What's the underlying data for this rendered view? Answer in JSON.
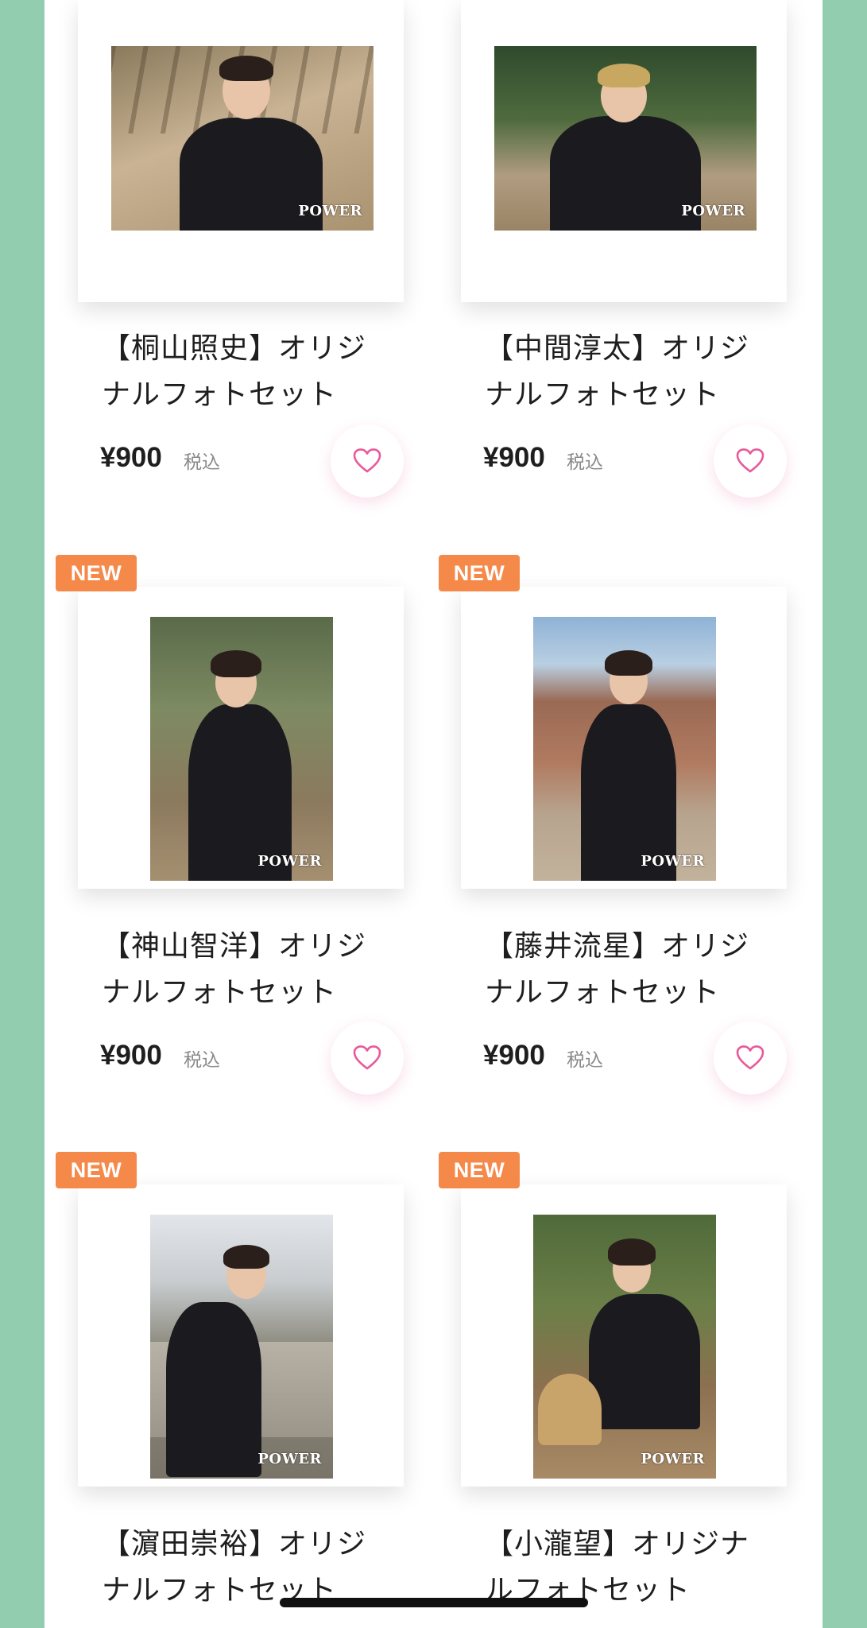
{
  "badge_text": "NEW",
  "tax_label": "税込",
  "colors": {
    "side_background": "#93cdb0",
    "badge": "#f5894a",
    "heart": "#e85a9a"
  },
  "photo_logo_text": "POWER",
  "products": [
    {
      "title_line1": "【桐山照史】オリジ",
      "title_line2": "ナルフォトセット",
      "price": "¥900",
      "is_new": false,
      "favorite_icon": "heart-outline-icon"
    },
    {
      "title_line1": "【中間淳太】オリジ",
      "title_line2": "ナルフォトセット",
      "price": "¥900",
      "is_new": false,
      "favorite_icon": "heart-outline-icon"
    },
    {
      "title_line1": "【神山智洋】オリジ",
      "title_line2": "ナルフォトセット",
      "price": "¥900",
      "is_new": true,
      "favorite_icon": "heart-outline-icon"
    },
    {
      "title_line1": "【藤井流星】オリジ",
      "title_line2": "ナルフォトセット",
      "price": "¥900",
      "is_new": true,
      "favorite_icon": "heart-outline-icon"
    },
    {
      "title_line1": "【濵田崇裕】オリジ",
      "title_line2": "ナルフォトセット",
      "price": "",
      "is_new": true,
      "favorite_icon": "heart-outline-icon"
    },
    {
      "title_line1": "【小瀧望】オリジナ",
      "title_line2": "ルフォトセット",
      "price": "",
      "is_new": true,
      "favorite_icon": "heart-outline-icon"
    }
  ]
}
